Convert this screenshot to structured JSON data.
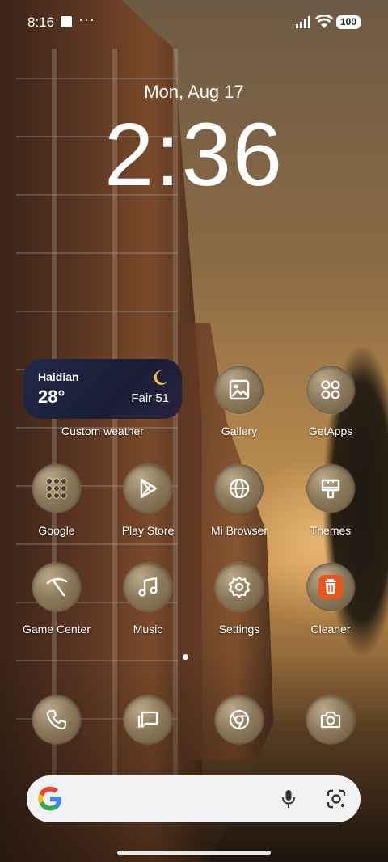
{
  "status_bar": {
    "time": "8:16",
    "battery": "100",
    "more_indicator": "···",
    "icons": [
      "notification-square-icon",
      "signal-icon",
      "wifi-icon",
      "battery-icon"
    ]
  },
  "lockscreen_clock": {
    "date": "Mon, Aug 17",
    "time": "2:36"
  },
  "weather_widget": {
    "city": "Haidian",
    "temperature": "28°",
    "condition": "Fair 51",
    "label": "Custom weather",
    "icon": "moon-icon"
  },
  "apps": [
    {
      "label": "Gallery",
      "icon": "gallery-icon"
    },
    {
      "label": "GetApps",
      "icon": "getapps-icon"
    },
    {
      "label": "Google",
      "icon": "google-folder-icon"
    },
    {
      "label": "Play Store",
      "icon": "play-store-icon"
    },
    {
      "label": "Mi Browser",
      "icon": "browser-globe-icon"
    },
    {
      "label": "Themes",
      "icon": "themes-brush-icon"
    },
    {
      "label": "Game Center",
      "icon": "game-center-icon"
    },
    {
      "label": "Music",
      "icon": "music-icon"
    },
    {
      "label": "Settings",
      "icon": "settings-gear-icon"
    },
    {
      "label": "Cleaner",
      "icon": "cleaner-trash-icon"
    }
  ],
  "dock": [
    {
      "name": "phone",
      "icon": "phone-icon"
    },
    {
      "name": "messages",
      "icon": "messages-icon"
    },
    {
      "name": "chrome",
      "icon": "chrome-icon"
    },
    {
      "name": "camera",
      "icon": "camera-icon"
    }
  ],
  "search_bar": {
    "icons": [
      "google-g-icon",
      "microphone-icon",
      "google-lens-icon"
    ]
  },
  "colors": {
    "cleaner_accent": "#e8561c",
    "weather_bg": "#1f2340",
    "search_bg": "#f1f2f4"
  }
}
